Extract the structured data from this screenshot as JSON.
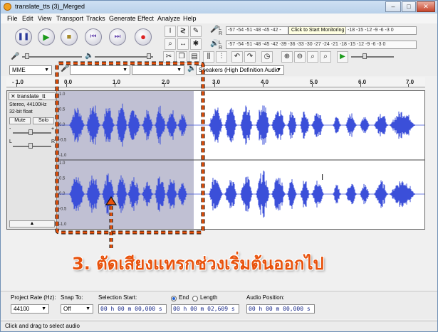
{
  "window": {
    "title": "translate_tts (3)_Merged",
    "minimize": "–",
    "maximize": "□",
    "close": "✕"
  },
  "menu": [
    "File",
    "Edit",
    "View",
    "Transport",
    "Tracks",
    "Generate",
    "Effect",
    "Analyze",
    "Help"
  ],
  "transport": {
    "pause_icon": "pause-icon",
    "play_icon": "play-icon",
    "stop_icon": "stop-icon",
    "skip_start_icon": "skip-start-icon",
    "skip_end_icon": "skip-end-icon",
    "record_icon": "record-icon"
  },
  "meters": {
    "record_scale": "-57 -54 -51 -48 -45 -42 -",
    "record_tooltip": "Click to Start Monitoring",
    "record_scale_right": "-18 -15 -12 -9 -6 -3 0",
    "play_scale": "-57 -54 -51 -48 -45 -42 -39 -36 -33 -30 -27 -24 -21 -18 -15 -12 -9 -6 -3 0",
    "channel_l": "L",
    "channel_r": "R"
  },
  "devices": {
    "host": "MME",
    "output": "Speakers (High Definition Audio"
  },
  "ruler": {
    "ticks": [
      "- 1.0",
      "0.0",
      "1.0",
      "2.0",
      "3.0",
      "4.0",
      "5.0",
      "6.0",
      "7.0"
    ]
  },
  "track": {
    "name": "translate_tt",
    "format": "Stereo, 44100Hz",
    "bits": "32-bit float",
    "mute": "Mute",
    "solo": "Solo",
    "gain_minus": "-",
    "gain_plus": "+",
    "pan_l": "L",
    "pan_r": "R",
    "scale": [
      "1.0",
      "0.5",
      "0.0",
      "-0.5",
      "-1.0"
    ]
  },
  "annotation": {
    "text": "3. ตัดเสียงแทรกช่วงเริ่มต้นออกไป",
    "color": "#e8520c"
  },
  "selection_bar": {
    "project_rate_label": "Project Rate (Hz):",
    "project_rate_value": "44100",
    "snap_to_label": "Snap To:",
    "snap_to_value": "Off",
    "selection_start_label": "Selection Start:",
    "selection_start_value": "00 h 00 m 00,000 s",
    "end_label": "End",
    "length_label": "Length",
    "end_value": "00 h 00 m 02,609 s",
    "audio_position_label": "Audio Position:",
    "audio_position_value": "00 h 00 m 00,000 s"
  },
  "status": "Click and drag to select audio",
  "colors": {
    "waveform": "#3b4fd9",
    "selection": "#8c8cae",
    "annotation": "#e8520c"
  }
}
